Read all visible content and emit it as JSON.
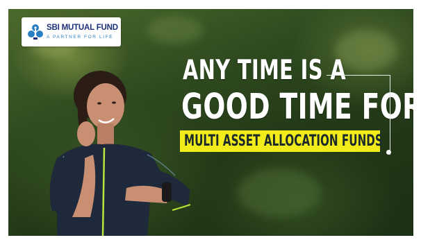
{
  "brand": {
    "name": "SBI MUTUAL FUND",
    "tagline": "A PARTNER FOR LIFE",
    "colors": {
      "navy": "#1c2f7a",
      "sky": "#2a7fc2"
    }
  },
  "headline": {
    "line1": "ANY TIME IS A",
    "line2": "GOOD TIME FOR",
    "highlight": "MULTI ASSET ALLOCATION FUNDS"
  },
  "colors": {
    "highlight_bg": "#f2ec1b",
    "headline_text": "#ffffff",
    "highlight_text": "#1c2a2a",
    "background": "#2f4a1f"
  },
  "icons": [
    "sbi-logo-icon",
    "smartwatch-icon"
  ]
}
